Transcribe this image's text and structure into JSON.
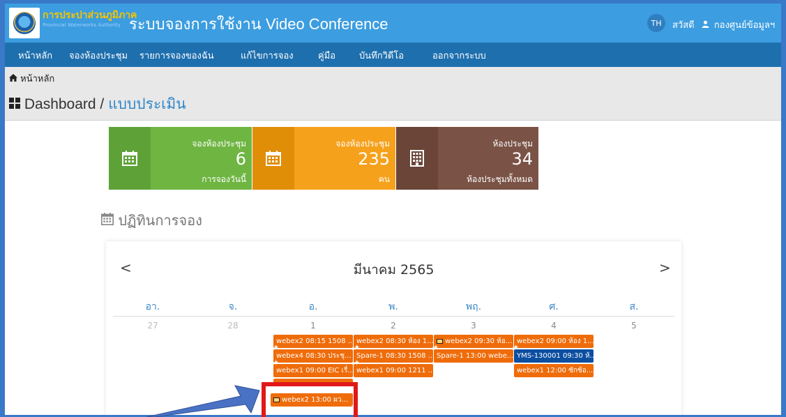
{
  "header": {
    "org_name": "การประปาส่วนภูมิภาค",
    "org_name_en": "Provincial Waterworks Authority",
    "app_title": "ระบบจองการใช้งาน Video Conference",
    "lang": "TH",
    "greeting": "สวัสดี",
    "user_name": "กองศูนย์ข้อมูลฯ",
    "icons": [
      "logo",
      "user-icon"
    ]
  },
  "nav": {
    "items": [
      {
        "label": "หน้าหลัก"
      },
      {
        "label": "จองห้องประชุม"
      },
      {
        "label": "รายการจองของฉัน"
      },
      {
        "label": "แก้ไขการจอง"
      },
      {
        "label": "คู่มือ"
      },
      {
        "label": "บันทึกวิดีโอ"
      },
      {
        "label": "ออกจากระบบ"
      }
    ]
  },
  "breadcrumb": {
    "home_label": "หน้าหลัก",
    "icon": "home-icon"
  },
  "page": {
    "title": "Dashboard",
    "separator": " / ",
    "subtitle": "แบบประเมิน",
    "icon": "dashboard-icon"
  },
  "stats": [
    {
      "label": "จองห้องประชุม",
      "value": "6",
      "sub": "การจองวันนี้",
      "color": "#6fb542",
      "icon_bg": "#5ea237",
      "icon": "calendar-icon"
    },
    {
      "label": "จองห้องประชุม",
      "value": "235",
      "sub": "คน",
      "color": "#f6a11c",
      "icon_bg": "#e08d08",
      "icon": "calendar-icon"
    },
    {
      "label": "ห้องประชุม",
      "value": "34",
      "sub": "ห้องประชุมทั้งหมด",
      "color": "#7a5346",
      "icon_bg": "#6a4538",
      "icon": "building-icon"
    }
  ],
  "calendar": {
    "heading": "ปฏิทินการจอง",
    "heading_icon": "calendar-icon",
    "prev": "<",
    "next": ">",
    "month": "มีนาคม 2565",
    "weekdays": [
      "อา.",
      "จ.",
      "อ.",
      "พ.",
      "พฤ.",
      "ศ.",
      "ส."
    ],
    "days": [
      "27",
      "28",
      "1",
      "2",
      "3",
      "4",
      "5"
    ],
    "events": {
      "tue": [
        "webex2 08:15 1508 ...",
        "webex4 08:30 ประชุ...",
        "webex1 09:00 EIC เรื่...",
        "webex2 13:00 ผว..."
      ],
      "wed": [
        "webex2 08:30 ห้อง 1...",
        "Spare-1 08:30 1508 ...",
        "webex1 09:00 1211 ..."
      ],
      "thu": [
        "webex2 09:30 ห้อ...",
        "Spare-1 13:00 webe..."
      ],
      "fri": [
        "webex2 09:00 ห้อง 1...",
        "YMS-130001 09:30 ห้...",
        "webex1 12:00 ซักซ้อ..."
      ]
    },
    "event_color": "#ef6c0a",
    "event_blue_color": "#0c4ea0"
  },
  "annotation": {
    "box_color": "#e01818",
    "arrow_color": "#4a72c4"
  }
}
